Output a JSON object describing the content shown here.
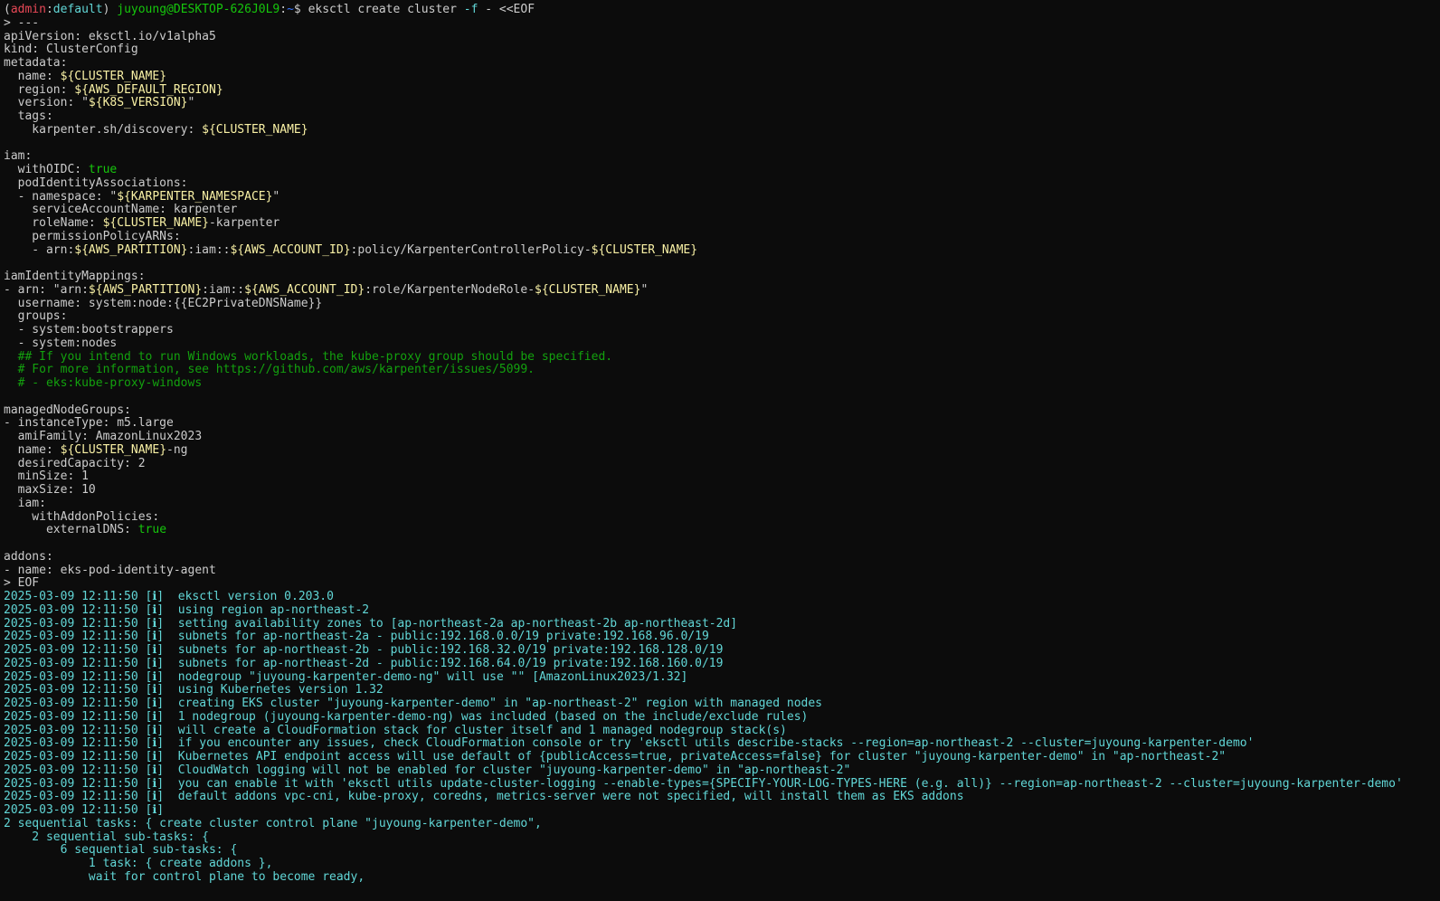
{
  "terminal": {
    "colors": {
      "background": "#0c0c0c",
      "text": "#cccccc",
      "prompt_user": "#16c60c",
      "prompt_env": "#e74856",
      "variable": "#f9f1a5",
      "boolean": "#16c60c",
      "comment": "#13a10e",
      "log": "#61d6d6"
    },
    "lines": [
      [
        [
          "white",
          "("
        ],
        [
          "red",
          "admin"
        ],
        [
          "white",
          ":"
        ],
        [
          "cyan",
          "default"
        ],
        [
          "white",
          ") "
        ],
        [
          "green",
          "juyoung@DESKTOP-626J0L9"
        ],
        [
          "white",
          ":"
        ],
        [
          "blue",
          "~"
        ],
        [
          "white",
          "$ eksctl create cluster "
        ],
        [
          "cyan",
          "-f"
        ],
        [
          "white",
          " - <<EOF"
        ]
      ],
      [
        [
          "white",
          "> ---"
        ]
      ],
      [
        [
          "white",
          "apiVersion: eksctl.io/v1alpha5"
        ]
      ],
      [
        [
          "white",
          "kind: ClusterConfig"
        ]
      ],
      [
        [
          "white",
          "metadata:"
        ]
      ],
      [
        [
          "white",
          "  name: "
        ],
        [
          "yellow",
          "${CLUSTER_NAME}"
        ]
      ],
      [
        [
          "white",
          "  region: "
        ],
        [
          "yellow",
          "${AWS_DEFAULT_REGION}"
        ]
      ],
      [
        [
          "white",
          "  version: \""
        ],
        [
          "yellow",
          "${K8S_VERSION}"
        ],
        [
          "white",
          "\""
        ]
      ],
      [
        [
          "white",
          "  tags:"
        ]
      ],
      [
        [
          "white",
          "    karpenter.sh/discovery: "
        ],
        [
          "yellow",
          "${CLUSTER_NAME}"
        ]
      ],
      [
        [
          "white",
          ""
        ]
      ],
      [
        [
          "white",
          "iam:"
        ]
      ],
      [
        [
          "white",
          "  withOIDC: "
        ],
        [
          "green",
          "true"
        ]
      ],
      [
        [
          "white",
          "  podIdentityAssociations:"
        ]
      ],
      [
        [
          "white",
          "  - namespace: \""
        ],
        [
          "yellow",
          "${KARPENTER_NAMESPACE}"
        ],
        [
          "white",
          "\""
        ]
      ],
      [
        [
          "white",
          "    serviceAccountName: karpenter"
        ]
      ],
      [
        [
          "white",
          "    roleName: "
        ],
        [
          "yellow",
          "${CLUSTER_NAME}"
        ],
        [
          "white",
          "-karpenter"
        ]
      ],
      [
        [
          "white",
          "    permissionPolicyARNs:"
        ]
      ],
      [
        [
          "white",
          "    - arn:"
        ],
        [
          "yellow",
          "${AWS_PARTITION}"
        ],
        [
          "white",
          ":iam::"
        ],
        [
          "yellow",
          "${AWS_ACCOUNT_ID}"
        ],
        [
          "white",
          ":policy/KarpenterControllerPolicy-"
        ],
        [
          "yellow",
          "${CLUSTER_NAME}"
        ]
      ],
      [
        [
          "white",
          ""
        ]
      ],
      [
        [
          "white",
          "iamIdentityMappings:"
        ]
      ],
      [
        [
          "white",
          "- arn: \"arn:"
        ],
        [
          "yellow",
          "${AWS_PARTITION}"
        ],
        [
          "white",
          ":iam::"
        ],
        [
          "yellow",
          "${AWS_ACCOUNT_ID}"
        ],
        [
          "white",
          ":role/KarpenterNodeRole-"
        ],
        [
          "yellow",
          "${CLUSTER_NAME}"
        ],
        [
          "white",
          "\""
        ]
      ],
      [
        [
          "white",
          "  username: system:node:{{EC2PrivateDNSName}}"
        ]
      ],
      [
        [
          "white",
          "  groups:"
        ]
      ],
      [
        [
          "white",
          "  - system:bootstrappers"
        ]
      ],
      [
        [
          "white",
          "  - system:nodes"
        ]
      ],
      [
        [
          "comment",
          "  ## If you intend to run Windows workloads, the kube-proxy group should be specified."
        ]
      ],
      [
        [
          "comment",
          "  # For more information, see https://github.com/aws/karpenter/issues/5099."
        ]
      ],
      [
        [
          "comment",
          "  # - eks:kube-proxy-windows"
        ]
      ],
      [
        [
          "white",
          ""
        ]
      ],
      [
        [
          "white",
          "managedNodeGroups:"
        ]
      ],
      [
        [
          "white",
          "- instanceType: m5.large"
        ]
      ],
      [
        [
          "white",
          "  amiFamily: AmazonLinux2023"
        ]
      ],
      [
        [
          "white",
          "  name: "
        ],
        [
          "yellow",
          "${CLUSTER_NAME}"
        ],
        [
          "white",
          "-ng"
        ]
      ],
      [
        [
          "white",
          "  desiredCapacity: 2"
        ]
      ],
      [
        [
          "white",
          "  minSize: 1"
        ]
      ],
      [
        [
          "white",
          "  maxSize: 10"
        ]
      ],
      [
        [
          "white",
          "  iam:"
        ]
      ],
      [
        [
          "white",
          "    withAddonPolicies:"
        ]
      ],
      [
        [
          "white",
          "      externalDNS: "
        ],
        [
          "green",
          "true"
        ]
      ],
      [
        [
          "white",
          ""
        ]
      ],
      [
        [
          "white",
          "addons:"
        ]
      ],
      [
        [
          "white",
          "- name: eks-pod-identity-agent"
        ]
      ],
      [
        [
          "white",
          "> EOF"
        ]
      ],
      [
        [
          "cyan",
          "2025-03-09 12:11:50 [ℹ]  eksctl version 0.203.0"
        ]
      ],
      [
        [
          "cyan",
          "2025-03-09 12:11:50 [ℹ]  using region ap-northeast-2"
        ]
      ],
      [
        [
          "cyan",
          "2025-03-09 12:11:50 [ℹ]  setting availability zones to [ap-northeast-2a ap-northeast-2b ap-northeast-2d]"
        ]
      ],
      [
        [
          "cyan",
          "2025-03-09 12:11:50 [ℹ]  subnets for ap-northeast-2a - public:192.168.0.0/19 private:192.168.96.0/19"
        ]
      ],
      [
        [
          "cyan",
          "2025-03-09 12:11:50 [ℹ]  subnets for ap-northeast-2b - public:192.168.32.0/19 private:192.168.128.0/19"
        ]
      ],
      [
        [
          "cyan",
          "2025-03-09 12:11:50 [ℹ]  subnets for ap-northeast-2d - public:192.168.64.0/19 private:192.168.160.0/19"
        ]
      ],
      [
        [
          "cyan",
          "2025-03-09 12:11:50 [ℹ]  nodegroup \"juyoung-karpenter-demo-ng\" will use \"\" [AmazonLinux2023/1.32]"
        ]
      ],
      [
        [
          "cyan",
          "2025-03-09 12:11:50 [ℹ]  using Kubernetes version 1.32"
        ]
      ],
      [
        [
          "cyan",
          "2025-03-09 12:11:50 [ℹ]  creating EKS cluster \"juyoung-karpenter-demo\" in \"ap-northeast-2\" region with managed nodes"
        ]
      ],
      [
        [
          "cyan",
          "2025-03-09 12:11:50 [ℹ]  1 nodegroup (juyoung-karpenter-demo-ng) was included (based on the include/exclude rules)"
        ]
      ],
      [
        [
          "cyan",
          "2025-03-09 12:11:50 [ℹ]  will create a CloudFormation stack for cluster itself and 1 managed nodegroup stack(s)"
        ]
      ],
      [
        [
          "cyan",
          "2025-03-09 12:11:50 [ℹ]  if you encounter any issues, check CloudFormation console or try 'eksctl utils describe-stacks --region=ap-northeast-2 --cluster=juyoung-karpenter-demo'"
        ]
      ],
      [
        [
          "cyan",
          "2025-03-09 12:11:50 [ℹ]  Kubernetes API endpoint access will use default of {publicAccess=true, privateAccess=false} for cluster \"juyoung-karpenter-demo\" in \"ap-northeast-2\""
        ]
      ],
      [
        [
          "cyan",
          "2025-03-09 12:11:50 [ℹ]  CloudWatch logging will not be enabled for cluster \"juyoung-karpenter-demo\" in \"ap-northeast-2\""
        ]
      ],
      [
        [
          "cyan",
          "2025-03-09 12:11:50 [ℹ]  you can enable it with 'eksctl utils update-cluster-logging --enable-types={SPECIFY-YOUR-LOG-TYPES-HERE (e.g. all)} --region=ap-northeast-2 --cluster=juyoung-karpenter-demo'"
        ]
      ],
      [
        [
          "cyan",
          "2025-03-09 12:11:50 [ℹ]  default addons vpc-cni, kube-proxy, coredns, metrics-server were not specified, will install them as EKS addons"
        ]
      ],
      [
        [
          "cyan",
          "2025-03-09 12:11:50 [ℹ]"
        ]
      ],
      [
        [
          "cyan",
          "2 sequential tasks: { create cluster control plane \"juyoung-karpenter-demo\","
        ]
      ],
      [
        [
          "cyan",
          "    2 sequential sub-tasks: {"
        ]
      ],
      [
        [
          "cyan",
          "        6 sequential sub-tasks: {"
        ]
      ],
      [
        [
          "cyan",
          "            1 task: { create addons },"
        ]
      ],
      [
        [
          "cyan",
          "            wait for control plane to become ready,"
        ]
      ]
    ]
  }
}
